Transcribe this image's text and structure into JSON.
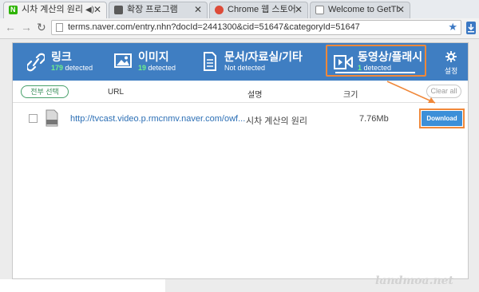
{
  "browser": {
    "tabs": [
      {
        "title": "시차 계산의 원리",
        "favicon_color": "#2db400",
        "icon": "naver-n-icon",
        "has_audio": true
      },
      {
        "title": "확장 프로그램",
        "favicon_color": "#5a5a5a",
        "icon": "puzzle-icon"
      },
      {
        "title": "Chrome 웹 스토어 -",
        "favicon_color": "#dd4b39",
        "icon": "chrome-store-icon"
      },
      {
        "title": "Welcome to GetThe",
        "favicon_color": "#888888",
        "icon": "page-icon"
      }
    ],
    "address": "terms.naver.com/entry.nhn?docId=2441300&cid=51647&categoryId=51647"
  },
  "extension": {
    "categories": [
      {
        "name": "링크",
        "count": "179",
        "detected_label": "detected",
        "icon": "link-icon"
      },
      {
        "name": "이미지",
        "count": "19",
        "detected_label": "detected",
        "icon": "image-icon"
      },
      {
        "name": "문서/자료실/기타",
        "detected_text": "Not detected",
        "icon": "document-icon"
      },
      {
        "name": "동영상/플래시",
        "count": "1",
        "detected_label": "detected",
        "icon": "video-icon",
        "selected": true
      }
    ],
    "settings_label": "설정",
    "select_all_label": "전부 선택",
    "columns": {
      "url": "URL",
      "description": "설명",
      "size": "크기"
    },
    "clear_all_label": "Clear all",
    "files": [
      {
        "type": "MP4",
        "url": "http://tvcast.video.p.rmcnmv.naver.com/owf...",
        "description": "시차 계산의 원리",
        "size": "7.76Mb",
        "download_label": "Download"
      }
    ]
  },
  "watermark": "landmoa.net",
  "colors": {
    "category_bar": "#3f7ec2",
    "highlight": "#f0883a",
    "detected_count": "#6ff08a",
    "download_button": "#3c8fd8"
  }
}
